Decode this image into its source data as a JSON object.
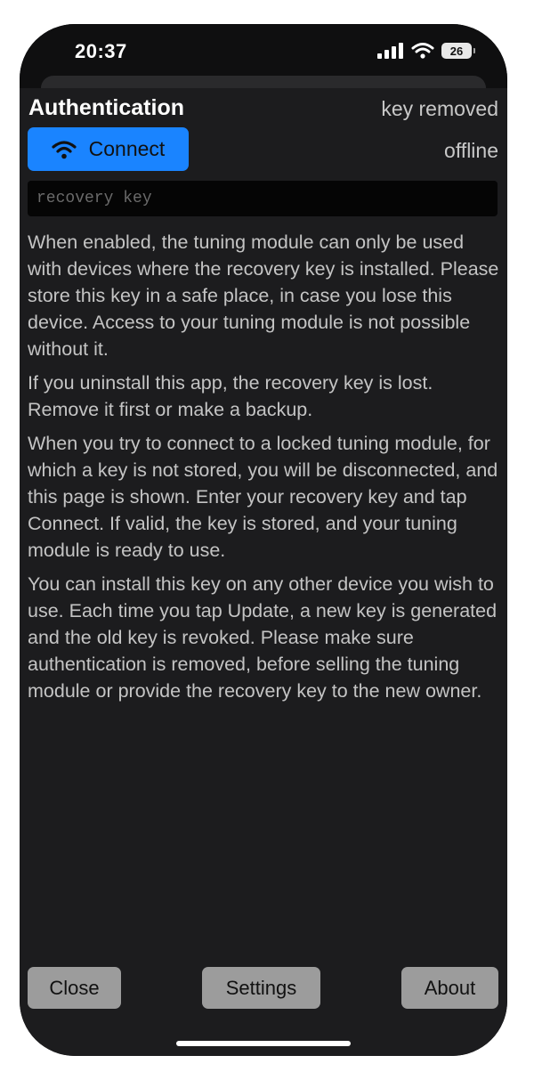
{
  "status_bar": {
    "time": "20:37",
    "battery": "26",
    "icons": [
      "cellular-signal-icon",
      "wifi-icon",
      "battery-icon"
    ]
  },
  "header": {
    "title": "Authentication",
    "key_status": "key removed"
  },
  "connect": {
    "label": "Connect",
    "icon": "wifi-icon",
    "status": "offline"
  },
  "recovery_key": {
    "value": "",
    "placeholder": "recovery key"
  },
  "description": {
    "paragraphs": [
      "When enabled, the tuning module can only be used with devices where the recovery key is installed. Please store this key in a safe place, in case you lose this device. Access to your tuning module is not possible without it.",
      "If you uninstall this app, the recovery key is lost. Remove it first or make a backup.",
      "When you try to connect to a locked tuning module, for which a key is not stored, you will be disconnected, and this page is shown. Enter your recovery key and tap Connect. If valid, the key is stored, and your tuning module is ready to use.",
      "You can install this key on any other device you wish to use. Each time you tap Update, a new key is generated and the old key is revoked. Please make sure authentication is removed, before selling the tuning module or provide the recovery key to the new owner."
    ]
  },
  "footer": {
    "close_label": "Close",
    "settings_label": "Settings",
    "about_label": "About"
  },
  "colors": {
    "accent": "#1a84ff",
    "background": "#1c1c1e",
    "button_gray": "#9c9c9c",
    "text": "#c4c4c4"
  }
}
